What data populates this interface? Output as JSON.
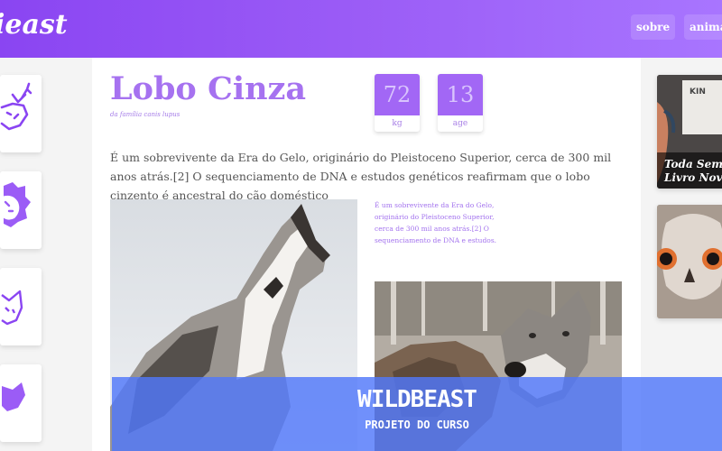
{
  "header": {
    "logo": "ieast",
    "nav": {
      "sobre": "sobre",
      "animais": "animai"
    }
  },
  "sidebar": {
    "icons": [
      "deer-icon",
      "lion-icon",
      "fox-icon",
      "bull-icon"
    ]
  },
  "article": {
    "title": "Lobo Cinza",
    "family": "da família canis lupus",
    "stats": [
      {
        "value": "72",
        "unit": "kg"
      },
      {
        "value": "13",
        "unit": "age"
      }
    ],
    "description": "É um sobrevivente da Era do Gelo, originário do Pleistoceno Superior, cerca de 300 mil anos atrás.[2] O sequenciamento de DNA e estudos genéticos reafirmam que o lobo cinzento é ancestral do cão doméstico",
    "side_note": "É um sobrevivente da Era do Gelo, originário do Pleistoceno Superior, cerca de 300 mil anos atrás.[2] O sequenciamento de DNA e estudos."
  },
  "right_cards": [
    {
      "top_text": "KIN",
      "caption_line1": "Toda Sema",
      "caption_line2": "Livro Nov"
    },
    {
      "image": "owl"
    }
  ],
  "banner": {
    "title": "WILDBEAST",
    "subtitle": "PROJETO DO CURSO"
  },
  "colors": {
    "primary": "#9b5cf6",
    "banner": "#5078fa",
    "title": "#a672f0"
  }
}
